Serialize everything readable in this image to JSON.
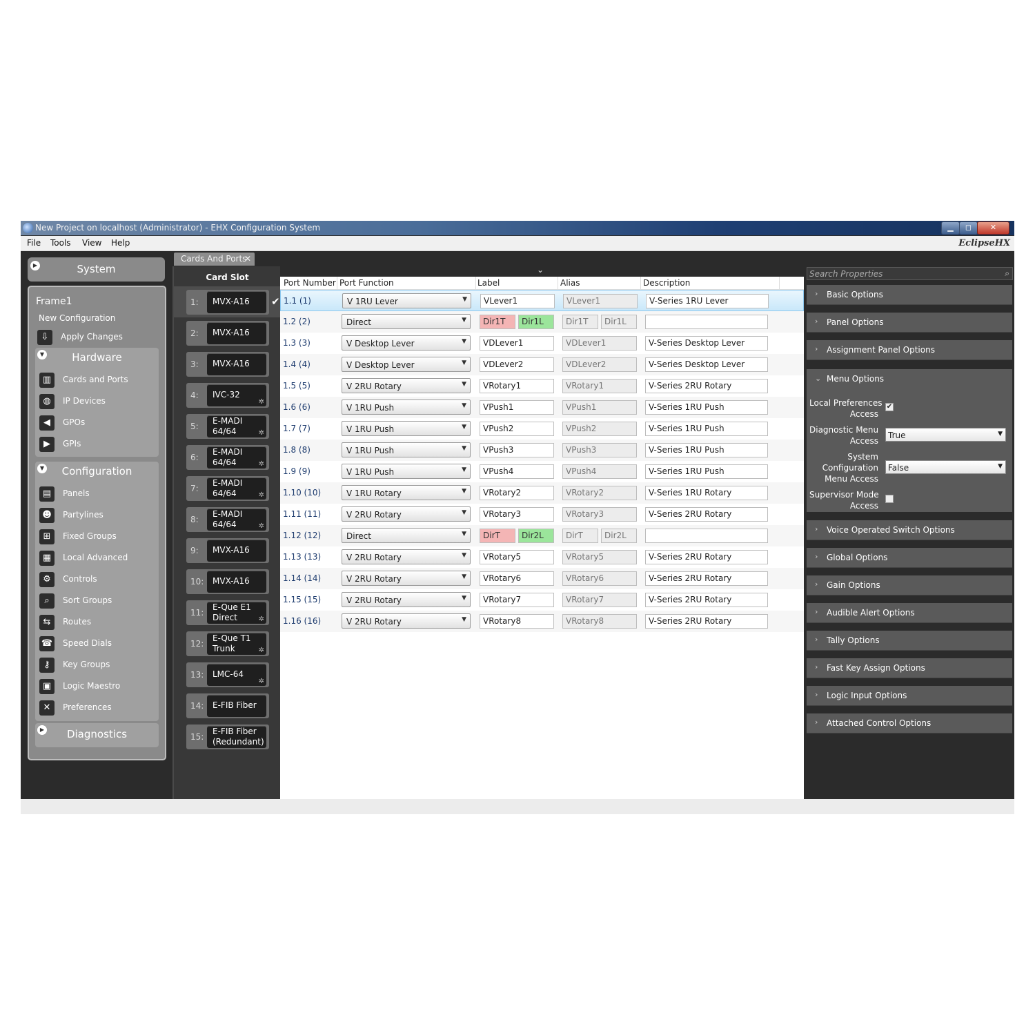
{
  "window": {
    "title": "New Project on localhost (Administrator) - EHX Configuration System",
    "brand": "EclipseHX",
    "min_symbol": "▁",
    "max_symbol": "◻",
    "close_symbol": "✕"
  },
  "menu": [
    "File",
    "Tools",
    "View",
    "Help"
  ],
  "sidebar": {
    "system_label": "System",
    "frame_name": "Frame1",
    "config_name": "New Configuration",
    "apply_label": "Apply Changes",
    "hardware": {
      "title": "Hardware",
      "items": [
        "Cards and Ports",
        "IP Devices",
        "GPOs",
        "GPIs"
      ]
    },
    "configuration": {
      "title": "Configuration",
      "items": [
        "Panels",
        "Partylines",
        "Fixed Groups",
        "Local Advanced",
        "Controls",
        "Sort Groups",
        "Routes",
        "Speed Dials",
        "Key Groups",
        "Logic Maestro",
        "Preferences"
      ]
    },
    "diagnostics_label": "Diagnostics"
  },
  "tab": {
    "label": "Cards And Ports",
    "close": "✕"
  },
  "card_slots": {
    "header": "Card Slot",
    "slots": [
      {
        "num": "1:",
        "label": "MVX-A16",
        "gear": false
      },
      {
        "num": "2:",
        "label": "MVX-A16",
        "gear": false
      },
      {
        "num": "3:",
        "label": "MVX-A16",
        "gear": false
      },
      {
        "num": "4:",
        "label": "IVC-32",
        "gear": true
      },
      {
        "num": "5:",
        "label": "E-MADI\n64/64",
        "gear": true
      },
      {
        "num": "6:",
        "label": "E-MADI\n64/64",
        "gear": true
      },
      {
        "num": "7:",
        "label": "E-MADI\n64/64",
        "gear": true
      },
      {
        "num": "8:",
        "label": "E-MADI\n64/64",
        "gear": true
      },
      {
        "num": "9:",
        "label": "MVX-A16",
        "gear": false
      },
      {
        "num": "10:",
        "label": "MVX-A16",
        "gear": false
      },
      {
        "num": "11:",
        "label": "E-Que E1\nDirect",
        "gear": true
      },
      {
        "num": "12:",
        "label": "E-Que T1\nTrunk",
        "gear": true
      },
      {
        "num": "13:",
        "label": "LMC-64",
        "gear": true
      },
      {
        "num": "14:",
        "label": "E-FIB Fiber",
        "gear": false
      },
      {
        "num": "15:",
        "label": "E-FIB Fiber\n(Redundant)",
        "gear": false
      }
    ]
  },
  "ports": {
    "columns": [
      "Port Number",
      "Port Function",
      "Label",
      "Alias",
      "Description"
    ],
    "rows": [
      {
        "num": "1.1 (1)",
        "func": "V 1RU Lever",
        "label": "VLever1",
        "alias": "VLever1",
        "desc": "V-Series 1RU Lever"
      },
      {
        "num": "1.2 (2)",
        "func": "Direct",
        "label_t": "Dir1T",
        "label_l": "Dir1L",
        "alias_t": "Dir1T",
        "alias_l": "Dir1L",
        "desc": ""
      },
      {
        "num": "1.3 (3)",
        "func": "V Desktop Lever",
        "label": "VDLever1",
        "alias": "VDLever1",
        "desc": "V-Series Desktop Lever"
      },
      {
        "num": "1.4 (4)",
        "func": "V Desktop Lever",
        "label": "VDLever2",
        "alias": "VDLever2",
        "desc": "V-Series Desktop Lever"
      },
      {
        "num": "1.5 (5)",
        "func": "V 2RU Rotary",
        "label": "VRotary1",
        "alias": "VRotary1",
        "desc": "V-Series 2RU Rotary"
      },
      {
        "num": "1.6 (6)",
        "func": "V 1RU Push",
        "label": "VPush1",
        "alias": "VPush1",
        "desc": "V-Series 1RU Push"
      },
      {
        "num": "1.7 (7)",
        "func": "V 1RU Push",
        "label": "VPush2",
        "alias": "VPush2",
        "desc": "V-Series 1RU Push"
      },
      {
        "num": "1.8 (8)",
        "func": "V 1RU Push",
        "label": "VPush3",
        "alias": "VPush3",
        "desc": "V-Series 1RU Push"
      },
      {
        "num": "1.9 (9)",
        "func": "V 1RU Push",
        "label": "VPush4",
        "alias": "VPush4",
        "desc": "V-Series 1RU Push"
      },
      {
        "num": "1.10 (10)",
        "func": "V 1RU Rotary",
        "label": "VRotary2",
        "alias": "VRotary2",
        "desc": "V-Series 1RU Rotary"
      },
      {
        "num": "1.11 (11)",
        "func": "V 2RU Rotary",
        "label": "VRotary3",
        "alias": "VRotary3",
        "desc": "V-Series 2RU Rotary"
      },
      {
        "num": "1.12 (12)",
        "func": "Direct",
        "label_t": "DirT",
        "label_l": "Dir2L",
        "alias_t": "DirT",
        "alias_l": "Dir2L",
        "desc": ""
      },
      {
        "num": "1.13 (13)",
        "func": "V 2RU Rotary",
        "label": "VRotary5",
        "alias": "VRotary5",
        "desc": "V-Series 2RU Rotary"
      },
      {
        "num": "1.14 (14)",
        "func": "V 2RU Rotary",
        "label": "VRotary6",
        "alias": "VRotary6",
        "desc": "V-Series 2RU Rotary"
      },
      {
        "num": "1.15 (15)",
        "func": "V 2RU Rotary",
        "label": "VRotary7",
        "alias": "VRotary7",
        "desc": "V-Series 2RU Rotary"
      },
      {
        "num": "1.16 (16)",
        "func": "V 2RU Rotary",
        "label": "VRotary8",
        "alias": "VRotary8",
        "desc": "V-Series 2RU Rotary"
      }
    ]
  },
  "properties": {
    "search_placeholder": "Search Properties",
    "sections_before": [
      "Basic Options",
      "Panel Options",
      "Assignment Panel Options"
    ],
    "open_section": {
      "title": "Menu Options",
      "local_pref_label": "Local Preferences\nAccess",
      "local_pref_checked": true,
      "diag_menu_label": "Diagnostic Menu\nAccess",
      "diag_menu_value": "True",
      "sys_config_label": "System\nConfiguration\nMenu Access",
      "sys_config_value": "False",
      "supervisor_label": "Supervisor Mode\nAccess",
      "supervisor_checked": false
    },
    "sections_after": [
      "Voice Operated Switch Options",
      "Global Options",
      "Gain Options",
      "Audible Alert Options",
      "Tally Options",
      "Fast Key Assign Options",
      "Logic Input Options",
      "Attached Control Options"
    ]
  },
  "colors": {
    "label_t_bg": "#f4b5b5",
    "label_l_bg": "#9be59b",
    "selected_row": "#c9e8fa"
  }
}
